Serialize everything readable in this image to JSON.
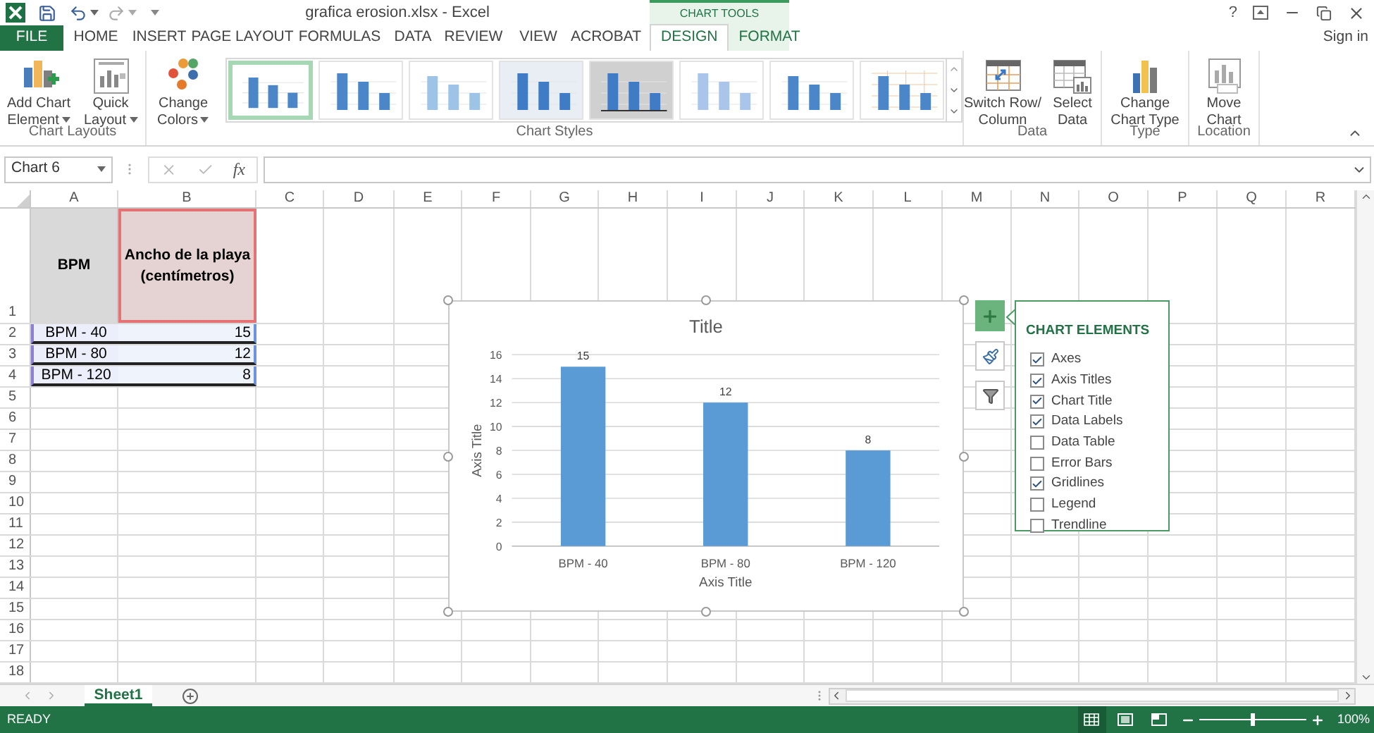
{
  "title_bar": {
    "title": "grafica erosion.xlsx - Excel",
    "help": "?",
    "context_label": "CHART TOOLS"
  },
  "tabs": [
    {
      "label": "FILE",
      "kind": "file",
      "selected": false
    },
    {
      "label": "HOME",
      "kind": "tab",
      "selected": false
    },
    {
      "label": "INSERT",
      "kind": "tab",
      "selected": false
    },
    {
      "label": "PAGE LAYOUT",
      "kind": "tab",
      "selected": false
    },
    {
      "label": "FORMULAS",
      "kind": "tab",
      "selected": false
    },
    {
      "label": "DATA",
      "kind": "tab",
      "selected": false
    },
    {
      "label": "REVIEW",
      "kind": "tab",
      "selected": false
    },
    {
      "label": "VIEW",
      "kind": "tab",
      "selected": false
    },
    {
      "label": "ACROBAT",
      "kind": "tab",
      "selected": false
    },
    {
      "label": "DESIGN",
      "kind": "context",
      "selected": true
    },
    {
      "label": "FORMAT",
      "kind": "context",
      "selected": false
    }
  ],
  "sign_in": "Sign in",
  "ribbon": {
    "groups": [
      {
        "label": "Chart Layouts",
        "buttons": [
          {
            "lines": [
              "Add Chart",
              "Element"
            ],
            "dropdown": true
          },
          {
            "lines": [
              "Quick",
              "Layout"
            ],
            "dropdown": true
          }
        ]
      },
      {
        "label": "Chart Styles",
        "buttons": [
          {
            "lines": [
              "Change",
              "Colors"
            ],
            "dropdown": true
          }
        ],
        "styles": [
          {
            "selected": true
          },
          {
            "selected": false
          },
          {
            "selected": false
          },
          {
            "selected": false
          },
          {
            "selected": false
          },
          {
            "selected": false
          },
          {
            "selected": false
          },
          {
            "selected": false
          }
        ]
      },
      {
        "label": "Data",
        "buttons": [
          {
            "lines": [
              "Switch Row/",
              "Column"
            ],
            "dropdown": false
          },
          {
            "lines": [
              "Select",
              "Data"
            ],
            "dropdown": false
          }
        ]
      },
      {
        "label": "Type",
        "buttons": [
          {
            "lines": [
              "Change",
              "Chart Type"
            ],
            "dropdown": false
          }
        ]
      },
      {
        "label": "Location",
        "buttons": [
          {
            "lines": [
              "Move",
              "Chart"
            ],
            "dropdown": false
          }
        ]
      }
    ]
  },
  "formula_bar": {
    "name_box": "Chart 6",
    "fx": "fx"
  },
  "sheet": {
    "columns": [
      "A",
      "B",
      "C",
      "D",
      "E",
      "F",
      "G",
      "H",
      "I",
      "J",
      "K",
      "L",
      "M",
      "N",
      "O",
      "P",
      "Q",
      "R"
    ],
    "rows": [
      {
        "header": "1",
        "cells": [
          "BPM",
          "Ancho de la playa (centímetros)"
        ]
      },
      {
        "header": "2",
        "cells": [
          "BPM - 40",
          "15"
        ]
      },
      {
        "header": "3",
        "cells": [
          "BPM - 80",
          "12"
        ]
      },
      {
        "header": "4",
        "cells": [
          "BPM - 120",
          "8"
        ]
      },
      {
        "header": "5"
      },
      {
        "header": "6"
      },
      {
        "header": "7"
      },
      {
        "header": "8"
      },
      {
        "header": "9"
      },
      {
        "header": "10"
      },
      {
        "header": "11"
      },
      {
        "header": "12"
      },
      {
        "header": "13"
      },
      {
        "header": "14"
      },
      {
        "header": "15"
      },
      {
        "header": "16"
      },
      {
        "header": "17"
      },
      {
        "header": "18"
      }
    ]
  },
  "chart": {
    "chart_data": {
      "type": "bar",
      "title": "Title",
      "xlabel": "Axis Title",
      "ylabel": "Axis Title",
      "categories": [
        "BPM - 40",
        "BPM - 80",
        "BPM - 120"
      ],
      "series": [
        {
          "color": "#5b9bd5",
          "values": [
            15,
            12,
            8
          ]
        }
      ],
      "ylim": [
        0,
        16
      ],
      "yticks": [
        0,
        2,
        4,
        6,
        8,
        10,
        12,
        14,
        16
      ],
      "data_labels": true,
      "grid": true
    }
  },
  "chart_elements": {
    "title": "CHART ELEMENTS",
    "items": [
      {
        "label": "Axes",
        "checked": true
      },
      {
        "label": "Axis Titles",
        "checked": true
      },
      {
        "label": "Chart Title",
        "checked": true
      },
      {
        "label": "Data Labels",
        "checked": true
      },
      {
        "label": "Data Table",
        "checked": false
      },
      {
        "label": "Error Bars",
        "checked": false
      },
      {
        "label": "Gridlines",
        "checked": true
      },
      {
        "label": "Legend",
        "checked": false
      },
      {
        "label": "Trendline",
        "checked": false
      }
    ]
  },
  "sheet_tabs": [
    {
      "label": "Sheet1",
      "selected": true
    }
  ],
  "status_bar": {
    "status": "READY",
    "zoom": {
      "level": 0.5,
      "reading": "100%"
    }
  }
}
